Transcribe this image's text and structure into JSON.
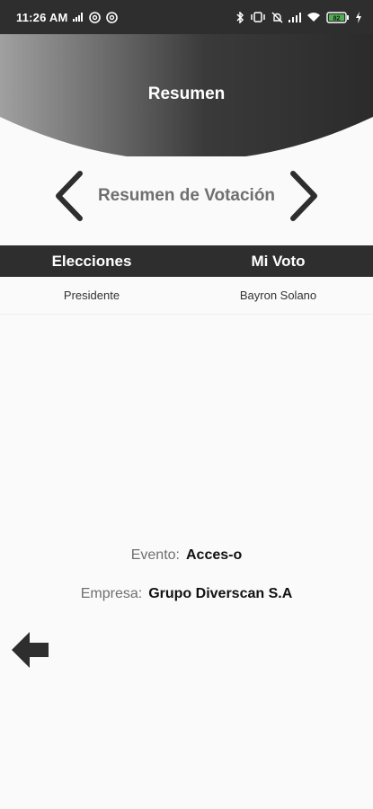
{
  "status_bar": {
    "time": "11:26 AM",
    "battery_level": "82",
    "left_icons": [
      "signal-icon",
      "at-sign-icon",
      "at-sign-icon"
    ],
    "right_icons": [
      "bluetooth-icon",
      "vibrate-icon",
      "alarm-off-icon",
      "signal-icon",
      "wifi-icon",
      "battery-icon",
      "charging-icon"
    ]
  },
  "header": {
    "title": "Resumen"
  },
  "navigation": {
    "title": "Resumen de Votación",
    "prev_icon": "chevron-left-icon",
    "next_icon": "chevron-right-icon"
  },
  "table": {
    "headers": [
      "Elecciones",
      "Mi Voto"
    ],
    "rows": [
      [
        "Presidente",
        "Bayron Solano"
      ]
    ]
  },
  "info": {
    "event_label": "Evento:",
    "event_value": "Acces-o",
    "company_label": "Empresa:",
    "company_value": "Grupo Diverscan S.A"
  },
  "back_button": {
    "icon": "arrow-left-icon"
  },
  "colors": {
    "dark": "#2e2e2e",
    "header_gradient_start": "#a0a0a0",
    "header_gradient_end": "#2b2b2b",
    "muted_text": "#6f6f6f",
    "background": "#fafafa"
  }
}
